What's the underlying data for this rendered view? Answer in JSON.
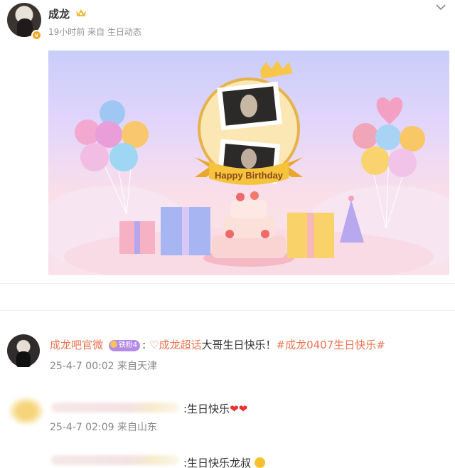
{
  "post": {
    "author": "成龙",
    "meta": "19小时前 来自 生日动态",
    "banner_caption": "Happy Birthday"
  },
  "comments": [
    {
      "user": "成龙吧官微",
      "fan_badge": "铁粉4",
      "separator": ":",
      "topic": "成龙超话",
      "text": "大哥生日快乐！",
      "hashtag": "#成龙0407生日快乐#",
      "time": "25-4-7 00:02 来自天津"
    },
    {
      "text": ":生日快乐",
      "hearts": "❤❤",
      "time": "25-4-7 02:09 来自山东"
    },
    {
      "text": ":生日快乐龙叔"
    }
  ],
  "colors": {
    "link": "#eb7350",
    "meta": "#939393",
    "fan_badge": "#b58be8"
  }
}
